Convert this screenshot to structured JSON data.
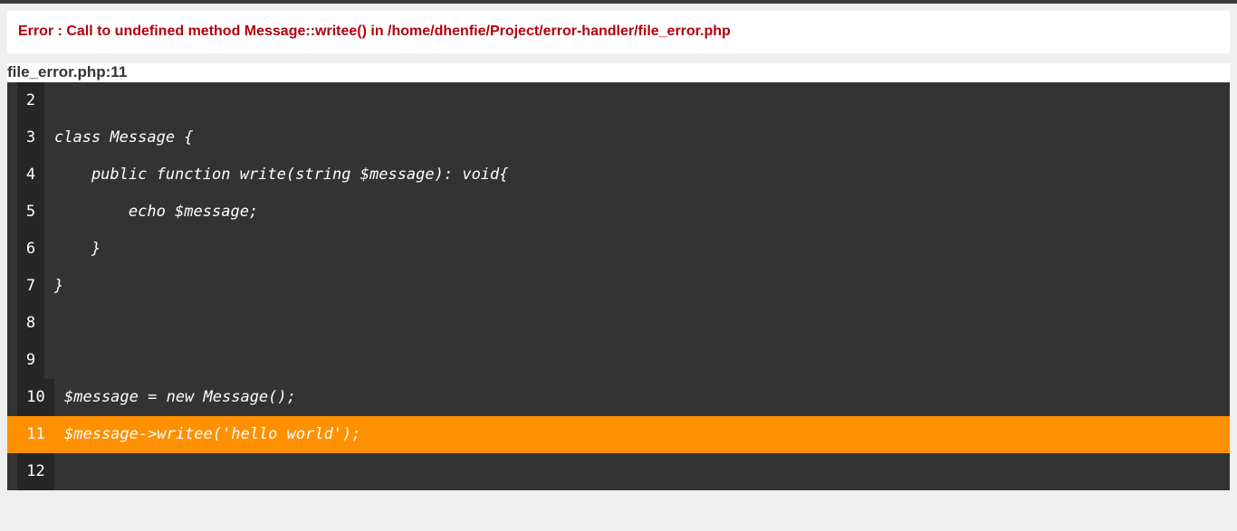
{
  "error": {
    "message": "Error : Call to undefined method Message::writee() in /home/dhenfie/Project/error-handler/file_error.php"
  },
  "file": {
    "label": "file_error.php:11"
  },
  "code": {
    "highlighted_line": "11",
    "lines": [
      {
        "num": "2",
        "text": ""
      },
      {
        "num": "3",
        "text": "class Message {"
      },
      {
        "num": "4",
        "text": "    public function write(string $message): void{"
      },
      {
        "num": "5",
        "text": "        echo $message;"
      },
      {
        "num": "6",
        "text": "    }"
      },
      {
        "num": "7",
        "text": "}"
      },
      {
        "num": "8",
        "text": ""
      },
      {
        "num": "9",
        "text": ""
      },
      {
        "num": "10",
        "text": "$message = new Message();"
      },
      {
        "num": "11",
        "text": "$message->writee('hello world');"
      },
      {
        "num": "12",
        "text": ""
      }
    ]
  },
  "colors": {
    "error_text": "#b3000c",
    "highlight": "#ff9000",
    "code_bg": "#333333",
    "gutter_bg": "#262626"
  }
}
